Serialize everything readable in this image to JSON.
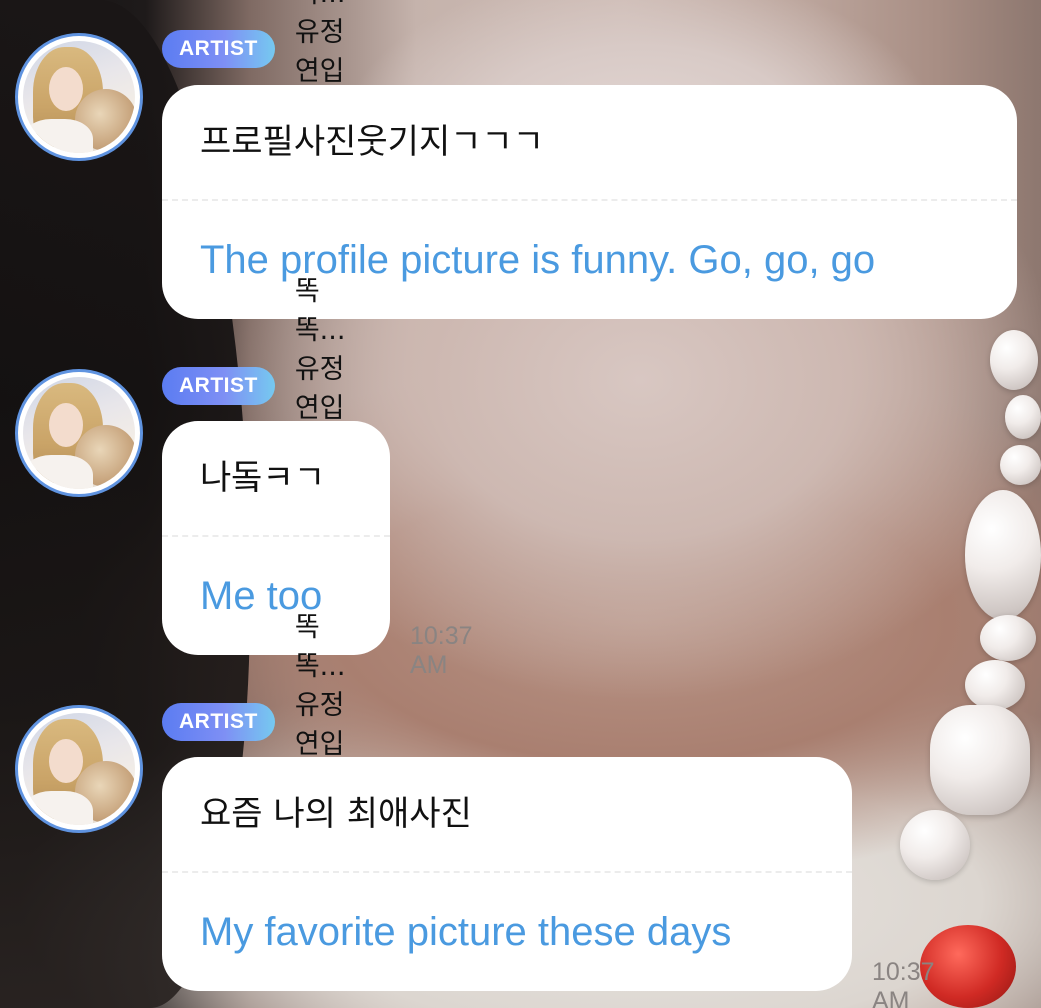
{
  "messages": [
    {
      "badge": "ARTIST",
      "nickname": "똑똑...유정연입니다만..",
      "original": "프로필사진웃기지ㄱㄱㄱ",
      "translation": "The profile picture is funny. Go, go, go",
      "time": ""
    },
    {
      "badge": "ARTIST",
      "nickname": "똑똑...유정연입니다만..",
      "original": "나돜ㅋㄱ",
      "translation": "Me too",
      "time": "10:37 AM"
    },
    {
      "badge": "ARTIST",
      "nickname": "똑똑...유정연입니다만..",
      "original": "요즘 나의 최애사진",
      "translation": "My favorite picture these days",
      "time": "10:37 AM"
    }
  ],
  "colors": {
    "badge_gradient_start": "#5b7cf2",
    "badge_gradient_end": "#76c9f0",
    "translation_text": "#4a9ae0",
    "avatar_ring": "#5f93e0",
    "bubble": "#ffffff"
  }
}
